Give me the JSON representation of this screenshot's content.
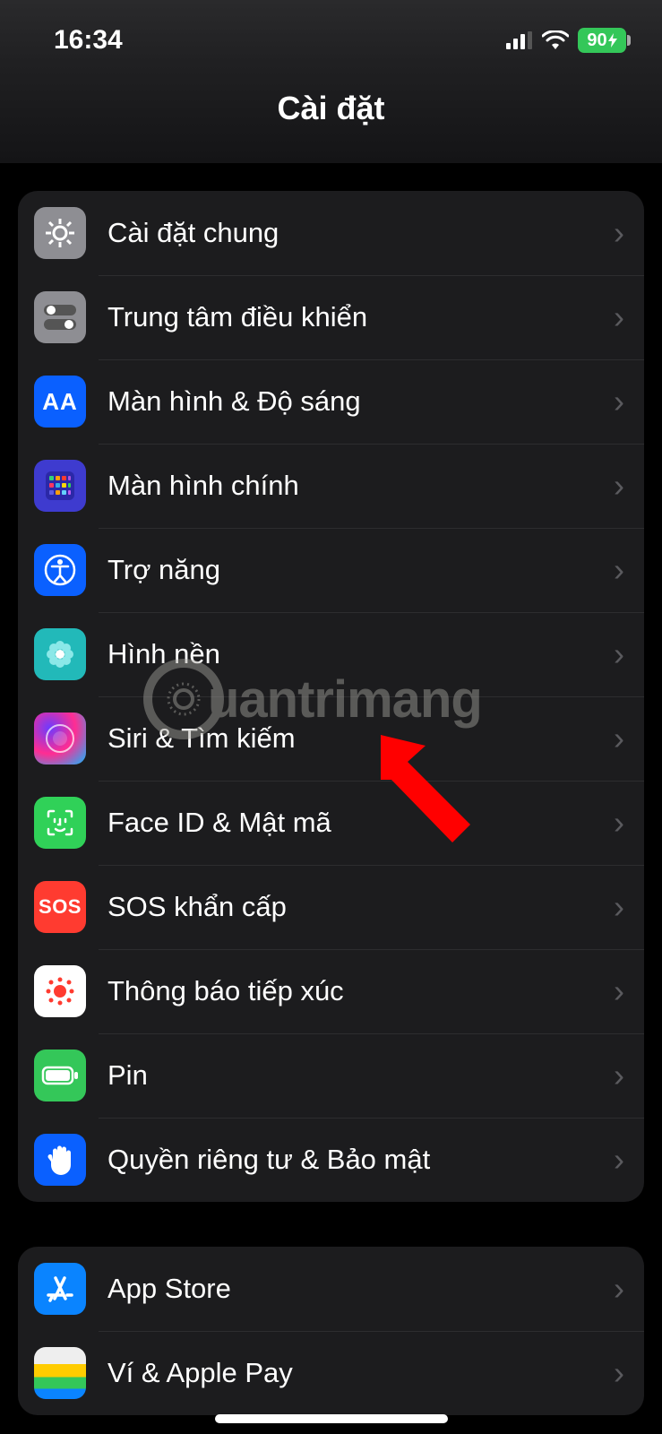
{
  "status": {
    "time": "16:34",
    "battery": "90"
  },
  "header": {
    "title": "Cài đặt"
  },
  "group1": [
    {
      "label": "Cài đặt chung",
      "icon": "gear-icon",
      "cls": "ic-general"
    },
    {
      "label": "Trung tâm điều khiển",
      "icon": "toggles-icon",
      "cls": "ic-control"
    },
    {
      "label": "Màn hình & Độ sáng",
      "icon": "textsize-icon",
      "cls": "ic-display"
    },
    {
      "label": "Màn hình chính",
      "icon": "appgrid-icon",
      "cls": "ic-home"
    },
    {
      "label": "Trợ năng",
      "icon": "accessibility-icon",
      "cls": "ic-access"
    },
    {
      "label": "Hình nền",
      "icon": "flower-icon",
      "cls": "ic-wall"
    },
    {
      "label": "Siri & Tìm kiếm",
      "icon": "siri-icon",
      "cls": "ic-siri"
    },
    {
      "label": "Face ID & Mật mã",
      "icon": "faceid-icon",
      "cls": "ic-face"
    },
    {
      "label": "SOS khẩn cấp",
      "icon": "sos-icon",
      "cls": "ic-sos"
    },
    {
      "label": "Thông báo tiếp xúc",
      "icon": "exposure-icon",
      "cls": "ic-expo"
    },
    {
      "label": "Pin",
      "icon": "battery-icon",
      "cls": "ic-batt"
    },
    {
      "label": "Quyền riêng tư & Bảo mật",
      "icon": "hand-icon",
      "cls": "ic-priv"
    }
  ],
  "group2": [
    {
      "label": "App Store",
      "icon": "appstore-icon",
      "cls": "ic-store"
    },
    {
      "label": "Ví & Apple Pay",
      "icon": "wallet-icon",
      "cls": "ic-wallet"
    }
  ],
  "watermark": "uantrimang"
}
